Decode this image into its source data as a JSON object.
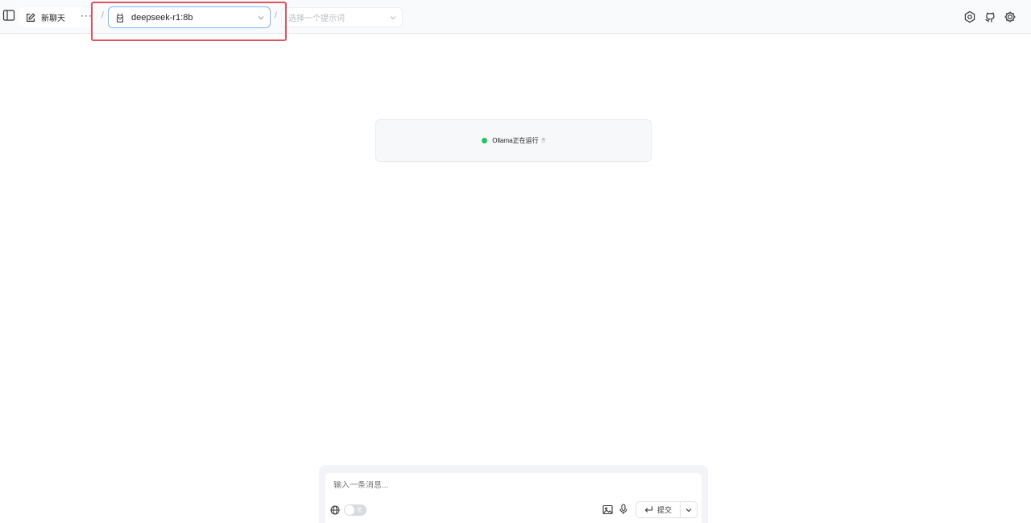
{
  "header": {
    "new_chat_label": "新聊天",
    "more_label": "···",
    "separator": "/",
    "model_select_value": "deepseek-r1:8b",
    "prompt_select_placeholder": "选择一个提示词"
  },
  "status": {
    "text": "Ollama正在运行",
    "extra": "🖱",
    "dot_color": "#22c55e"
  },
  "composer": {
    "placeholder": "输入一条消息...",
    "web_toggle_label": "关",
    "submit_label": "提交"
  },
  "icons": {
    "sidebar": "sidebar-toggle-icon",
    "new_chat": "edit-icon",
    "model": "llama-icon",
    "chevron": "chevron-down-icon",
    "settings": "settings-icon",
    "github": "github-icon",
    "gear": "gear-icon",
    "globe": "globe-icon",
    "image": "image-icon",
    "mic": "mic-icon",
    "enter": "enter-icon"
  },
  "colors": {
    "highlight": "#e1545e",
    "model_border": "#7ab8f5",
    "status_dot": "#22c55e"
  }
}
